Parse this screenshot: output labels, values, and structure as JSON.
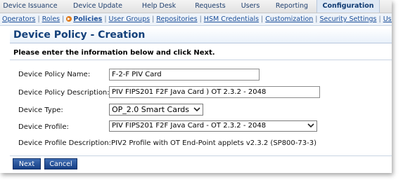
{
  "top_nav": {
    "tabs": [
      {
        "label": "Device Issuance",
        "active": false
      },
      {
        "label": "Device Update",
        "active": false
      },
      {
        "label": "Help Desk",
        "active": false
      },
      {
        "label": "Requests",
        "active": false
      },
      {
        "label": "Users",
        "active": false
      },
      {
        "label": "Reporting",
        "active": false
      },
      {
        "label": "Configuration",
        "active": true
      }
    ]
  },
  "sub_nav": {
    "items": [
      {
        "label": "Operators"
      },
      {
        "label": "Roles"
      },
      {
        "label": "Policies",
        "active": true
      },
      {
        "label": "User Groups"
      },
      {
        "label": "Repositories"
      },
      {
        "label": "HSM Credentials"
      },
      {
        "label": "Customization"
      },
      {
        "label": "Security Settings"
      },
      {
        "label": "User Portal"
      }
    ]
  },
  "page": {
    "title": "Device Policy - Creation",
    "instructions": "Please enter the information below and click Next."
  },
  "form": {
    "policy_name": {
      "label": "Device Policy Name:",
      "value": "F-2-F PIV Card"
    },
    "policy_description": {
      "label": "Device Policy Description:",
      "value": "PIV FIPS201 F2F Java Card ) OT 2.3.2 - 2048"
    },
    "device_type": {
      "label": "Device Type:",
      "selected": "OP_2.0 Smart Cards"
    },
    "device_profile": {
      "label": "Device Profile:",
      "selected": "PIV FIPS201 F2F Java Card - OT 2.3.2 - 2048"
    },
    "profile_description": {
      "label": "Device Profile Description:",
      "value": "PIV2 Profile with OT End-Point applets v2.3.2 (SP800-73-3)"
    }
  },
  "buttons": {
    "next": "Next",
    "cancel": "Cancel"
  },
  "colors": {
    "title": "#13407a",
    "button": "#1f4a92",
    "active_tab": "#dfe9f5",
    "nav_link": "#1c4f99",
    "policy_bullet": "#e07a1b"
  }
}
